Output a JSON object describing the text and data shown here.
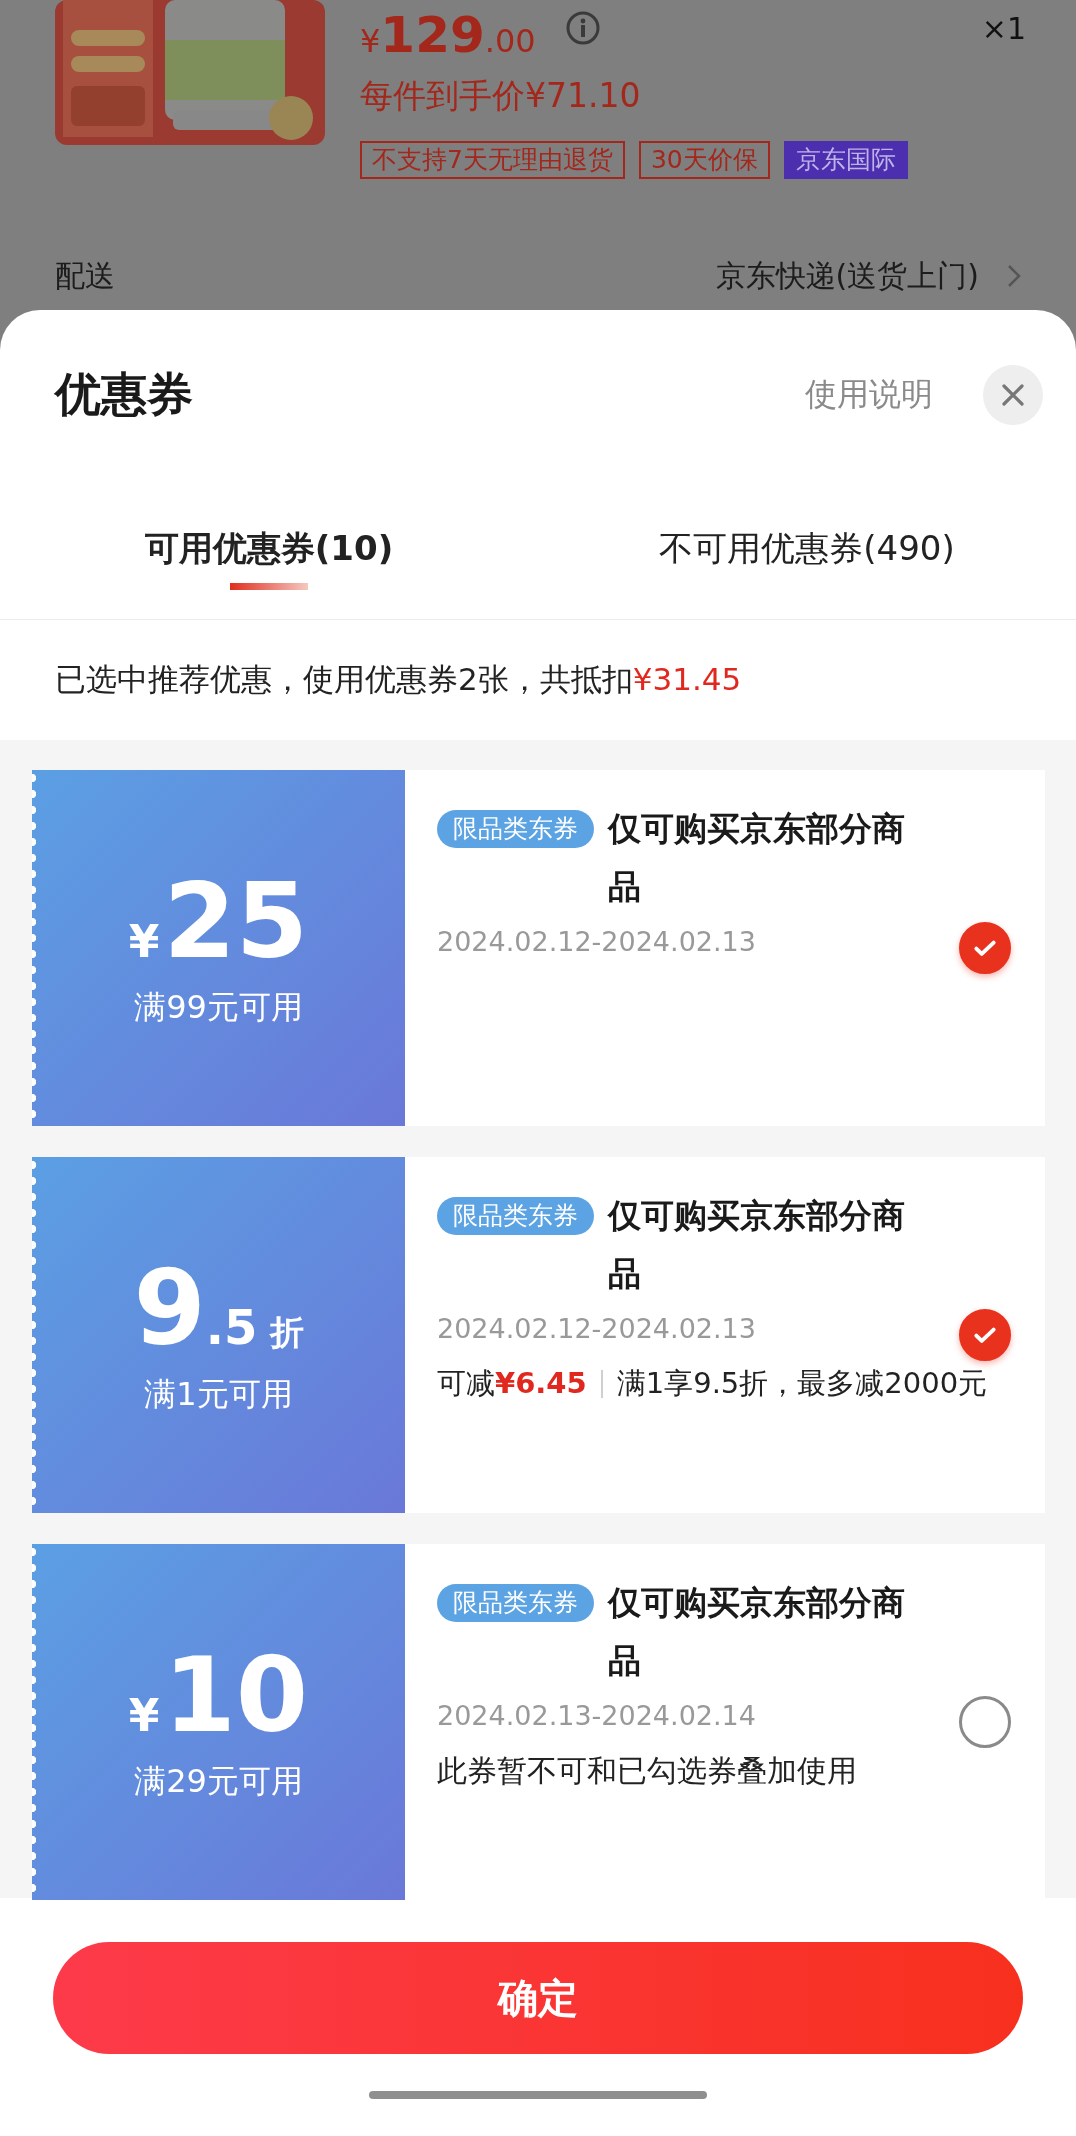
{
  "product": {
    "kind": "picture",
    "price": {
      "symbol": "¥",
      "integer": "129",
      "decimal": ".00"
    },
    "quantity": "×1",
    "final_price": "每件到手价¥71.10",
    "tags": [
      {
        "label": "不支持7天无理由退货",
        "kind": "outline"
      },
      {
        "label": "30天价保",
        "kind": "outline"
      },
      {
        "label": "京东国际",
        "kind": "filled"
      }
    ],
    "delivery": {
      "label": "配送",
      "value": "京东快递(送货上门)"
    }
  },
  "sheet": {
    "title": "优惠券",
    "help_link": "使用说明",
    "tabs": [
      {
        "label": "可用优惠券(10)",
        "selected": true
      },
      {
        "label": "不可用优惠券(490)",
        "selected": false
      }
    ],
    "summary": {
      "text": "已选中推荐优惠，使用优惠券2张，共抵扣",
      "amount": "¥31.45"
    },
    "coupons": [
      {
        "kind": "cash",
        "symbol": "¥",
        "value": "25",
        "condition": "满99元可用",
        "tag": "限品类东券",
        "title": "仅可购买京东部分商品",
        "dates": "2024.02.12-2024.02.13",
        "checked": true
      },
      {
        "kind": "discount",
        "value": "9",
        "fraction": ".5",
        "unit": "折",
        "condition": "满1元可用",
        "tag": "限品类东券",
        "title": "仅可购买京东部分商品",
        "dates": "2024.02.12-2024.02.13",
        "savings": {
          "label": "可减",
          "amount": "¥6.45",
          "detail": "满1享9.5折，最多减2000元"
        },
        "checked": true
      },
      {
        "kind": "cash",
        "symbol": "¥",
        "value": "10",
        "condition": "满29元可用",
        "tag": "限品类东券",
        "title": "仅可购买京东部分商品",
        "dates": "2024.02.13-2024.02.14",
        "note": "此券暂不可和已勾选券叠加使用",
        "checked": false
      }
    ],
    "confirm_button": "确定"
  }
}
